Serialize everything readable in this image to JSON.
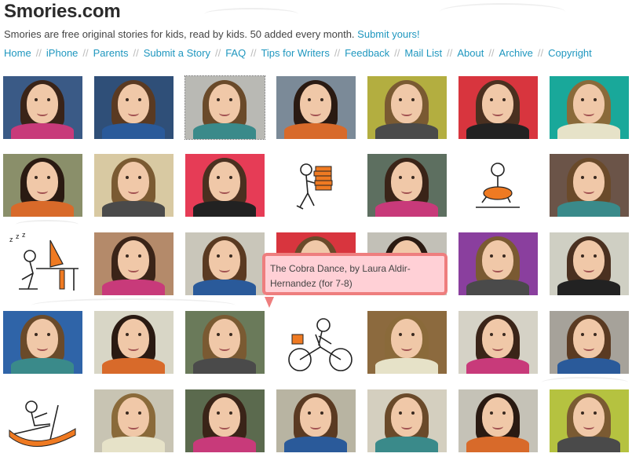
{
  "site": {
    "title": "Smories.com",
    "tagline": "Smories are free original stories for kids, read by kids. 50 added every month.",
    "submit_link": "Submit yours!"
  },
  "nav": [
    "Home",
    "iPhone",
    "Parents",
    "Submit a Story",
    "FAQ",
    "Tips for Writers",
    "Feedback",
    "Mail List",
    "About",
    "Archive",
    "Copyright"
  ],
  "nav_separator": "//",
  "colors": {
    "link": "#1f97bf",
    "tooltip_bg": "#ffd0d6",
    "tooltip_border": "#ee7e7e"
  },
  "tooltip": {
    "text": "The Cobra Dance, by Laura Aldir-Hernandez (for 7-8)"
  },
  "selected_tile": "row-1-col-3",
  "grid_rows": [
    [
      "portrait",
      "portrait",
      "portrait",
      "portrait",
      "portrait",
      "portrait",
      "portrait"
    ],
    [
      "portrait",
      "portrait",
      "portrait",
      "drawing-books-carrier",
      "portrait",
      "drawing-swimmer",
      "portrait"
    ],
    [
      "drawing-sleeping-computer",
      "portrait",
      "portrait",
      "portrait",
      "portrait",
      "portrait",
      "portrait"
    ],
    [
      "portrait",
      "portrait",
      "portrait",
      "drawing-cyclist",
      "portrait",
      "portrait",
      "portrait"
    ],
    [
      "drawing-rowboat",
      "portrait",
      "portrait",
      "portrait",
      "portrait",
      "portrait",
      "portrait"
    ]
  ]
}
